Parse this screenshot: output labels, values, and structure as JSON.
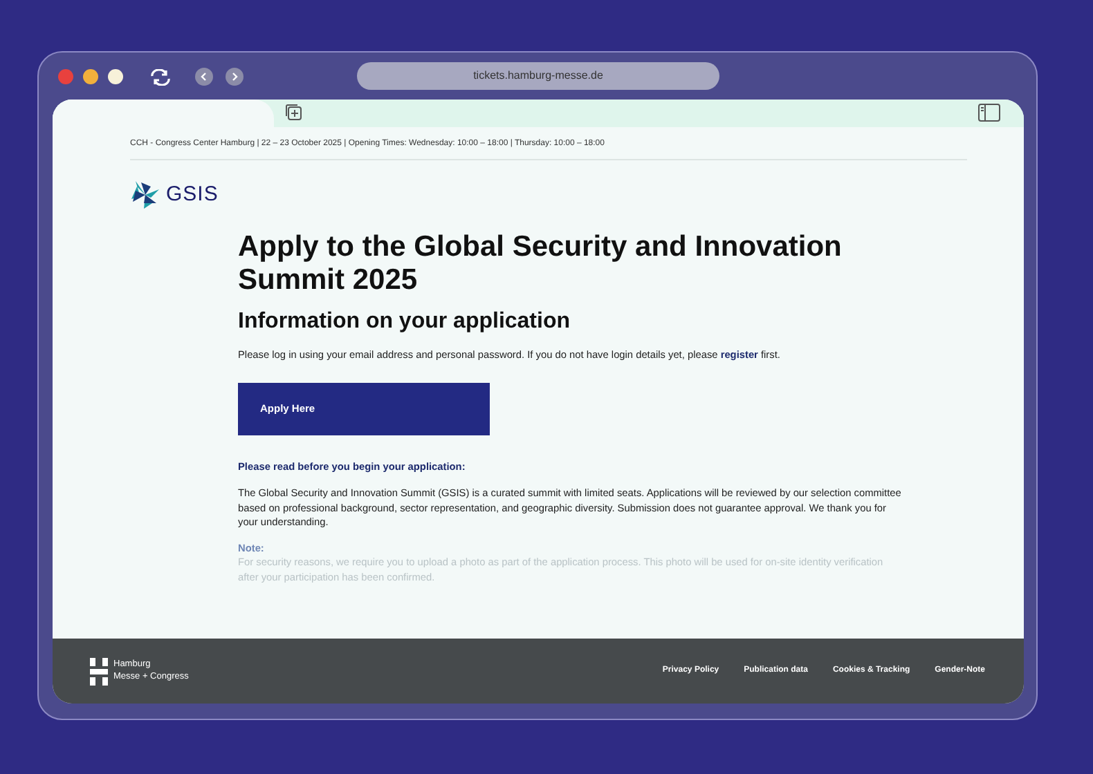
{
  "browser": {
    "url": "tickets.hamburg-messe.de"
  },
  "page": {
    "info_bar": "CCH - Congress Center Hamburg | 22 – 23 October 2025 | Opening Times: Wednesday: 10:00 – 18:00 | Thursday: 10:00 – 18:00",
    "logo_text": "GSIS",
    "title": "Apply to the Global Security and Innovation Summit 2025",
    "subtitle": "Information on your application",
    "intro_before": "Please log in using your email address and personal password. If you do not have login details yet, please",
    "intro_link": "register",
    "intro_after": "first.",
    "apply_button": "Apply Here",
    "notice_heading": "Please read before you begin your application:",
    "notice_text": "The Global Security and Innovation Summit (GSIS) is a curated summit with limited seats. Applications will be reviewed by our selection committee based on professional background, sector representation, and geographic diversity. Submission does not guarantee approval. We thank you for your understanding.",
    "note_label": "Note:",
    "note_text": "For security reasons, we require you to upload a photo as part of the application process. This photo will be used for on-site identity verification after your participation has been confirmed."
  },
  "footer": {
    "brand_lines": [
      "Hamburg",
      "Messe + Congress"
    ],
    "links": [
      "Privacy Policy",
      "Publication data",
      "Cookies & Tracking",
      "Gender-Note"
    ]
  }
}
